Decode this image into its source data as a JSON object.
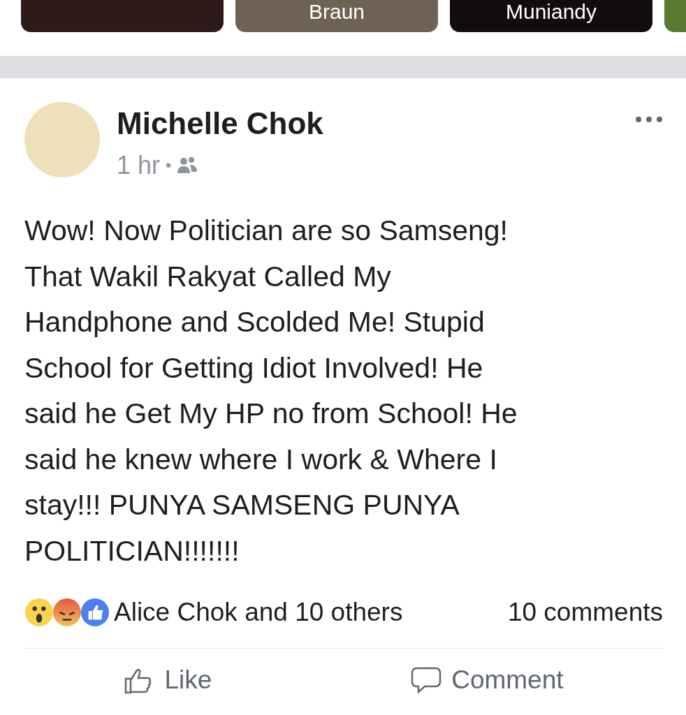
{
  "stories": [
    {
      "kind": "dark"
    },
    {
      "kind": "light",
      "name": "Braun"
    },
    {
      "kind": "dark",
      "name": "Muniandy"
    },
    {
      "kind": "green"
    }
  ],
  "post": {
    "author": "Michelle Chok",
    "time": "1 hr",
    "separator": "•",
    "text": "Wow! Now Politician are so Samseng!\nThat Wakil Rakyat Called My\nHandphone and Scolded Me! Stupid\nSchool for Getting Idiot Involved! He\nsaid he Get My HP no from School! He\nsaid he knew where I work & Where I\nstay!!! PUNYA SAMSENG PUNYA\nPOLITICIAN!!!!!!!",
    "reactions": [
      {
        "kind": "wow"
      },
      {
        "kind": "angry"
      },
      {
        "kind": "like"
      }
    ],
    "reaction_summary": "Alice Chok and 10 others",
    "comments": "10 comments",
    "actions": [
      {
        "kind": "like",
        "label": "Like"
      },
      {
        "kind": "comment",
        "label": "Comment"
      }
    ]
  }
}
